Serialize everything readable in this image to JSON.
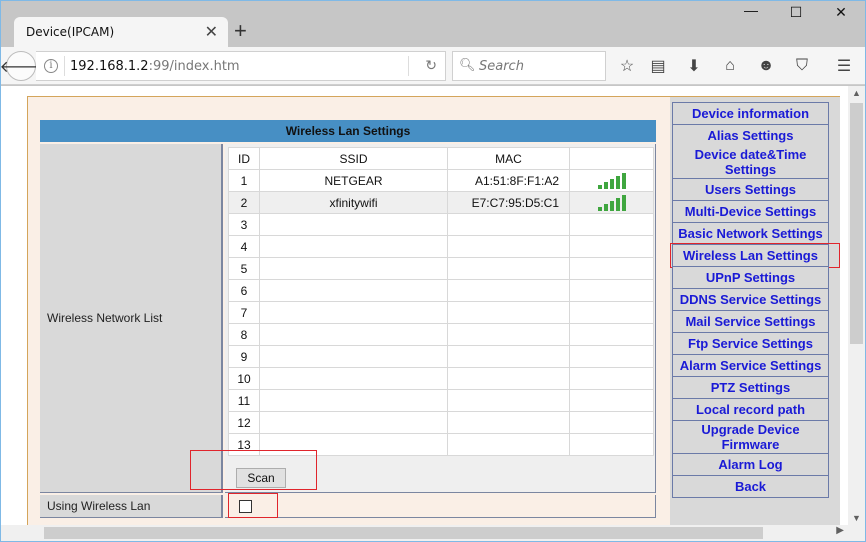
{
  "browser": {
    "tab_title": "Device(IPCAM)",
    "url_host": "192.168.1.2",
    "url_rest": ":99/index.htm",
    "search_placeholder": "Search",
    "icons": [
      "back-arrow-icon",
      "info-icon",
      "reload-icon",
      "search-icon",
      "bookmark-star-icon",
      "reading-list-icon",
      "download-icon",
      "home-icon",
      "chat-icon",
      "pocket-icon",
      "hamburger-menu-icon"
    ]
  },
  "panel": {
    "title": "Wireless Lan Settings",
    "list_label": "Wireless Network List",
    "using_label": "Using Wireless Lan",
    "scan_label": "Scan",
    "using_wireless_checked": false,
    "columns": [
      "ID",
      "SSID",
      "MAC",
      ""
    ],
    "rows": [
      {
        "id": "1",
        "ssid": "NETGEAR",
        "mac": "A1:51:8F:F1:A2",
        "signal": 5
      },
      {
        "id": "2",
        "ssid": "xfinitywifi",
        "mac": "E7:C7:95:D5:C1",
        "signal": 5
      },
      {
        "id": "3",
        "ssid": "",
        "mac": "",
        "signal": 0
      },
      {
        "id": "4",
        "ssid": "",
        "mac": "",
        "signal": 0
      },
      {
        "id": "5",
        "ssid": "",
        "mac": "",
        "signal": 0
      },
      {
        "id": "6",
        "ssid": "",
        "mac": "",
        "signal": 0
      },
      {
        "id": "7",
        "ssid": "",
        "mac": "",
        "signal": 0
      },
      {
        "id": "8",
        "ssid": "",
        "mac": "",
        "signal": 0
      },
      {
        "id": "9",
        "ssid": "",
        "mac": "",
        "signal": 0
      },
      {
        "id": "10",
        "ssid": "",
        "mac": "",
        "signal": 0
      },
      {
        "id": "11",
        "ssid": "",
        "mac": "",
        "signal": 0
      },
      {
        "id": "12",
        "ssid": "",
        "mac": "",
        "signal": 0
      },
      {
        "id": "13",
        "ssid": "",
        "mac": "",
        "signal": 0
      }
    ]
  },
  "menu": {
    "items": [
      "Device information",
      "Alias Settings",
      "Device date&Time Settings",
      "Users Settings",
      "Multi-Device Settings",
      "Basic Network Settings",
      "Wireless Lan Settings",
      "UPnP Settings",
      "DDNS Service Settings",
      "Mail Service Settings",
      "Ftp Service Settings",
      "Alarm Service Settings",
      "PTZ Settings",
      "Local record path",
      "Upgrade Device Firmware",
      "Alarm Log",
      "Back"
    ],
    "active": "Wireless Lan Settings"
  },
  "colors": {
    "panel_header": "#478fc4",
    "menu_link": "#1a1ad6",
    "signal_bar": "#3fa63f",
    "highlight": "#e0252c"
  }
}
